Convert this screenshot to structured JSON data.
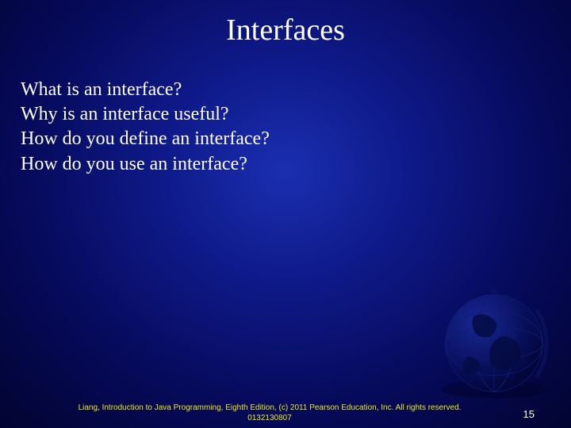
{
  "title": "Interfaces",
  "bullets": [
    "What is an interface?",
    "Why is an interface useful?",
    "How do you define an interface?",
    "How do you use an interface?"
  ],
  "footer": "Liang, Introduction to Java Programming, Eighth Edition, (c) 2011 Pearson Education, Inc. All rights reserved. 0132130807",
  "page_number": "15"
}
